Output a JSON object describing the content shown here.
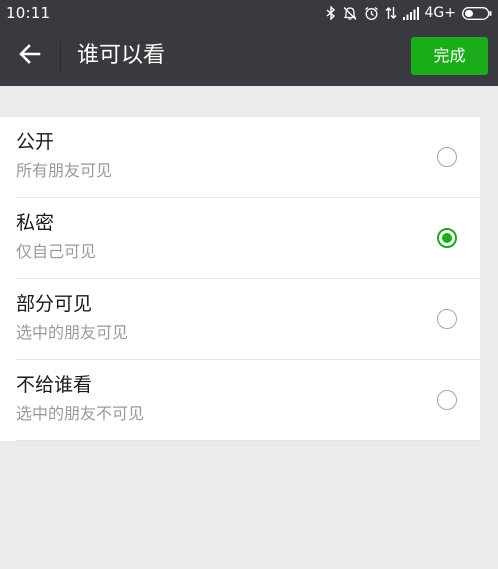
{
  "status_bar": {
    "time": "10:11",
    "network": "4G+",
    "icons": [
      "bluetooth-icon",
      "vibrate-icon",
      "alarm-icon",
      "data-transfer-icon",
      "signal-icon",
      "battery-icon"
    ]
  },
  "toolbar": {
    "title": "谁可以看",
    "done_label": "完成",
    "back_icon": "arrow-left-icon"
  },
  "colors": {
    "toolbar_bg": "#393a3f",
    "accent_green": "#1aad19",
    "page_bg": "#ebebeb"
  },
  "options": [
    {
      "title": "公开",
      "desc": "所有朋友可见",
      "selected": false
    },
    {
      "title": "私密",
      "desc": "仅自己可见",
      "selected": true
    },
    {
      "title": "部分可见",
      "desc": "选中的朋友可见",
      "selected": false
    },
    {
      "title": "不给谁看",
      "desc": "选中的朋友不可见",
      "selected": false
    }
  ]
}
